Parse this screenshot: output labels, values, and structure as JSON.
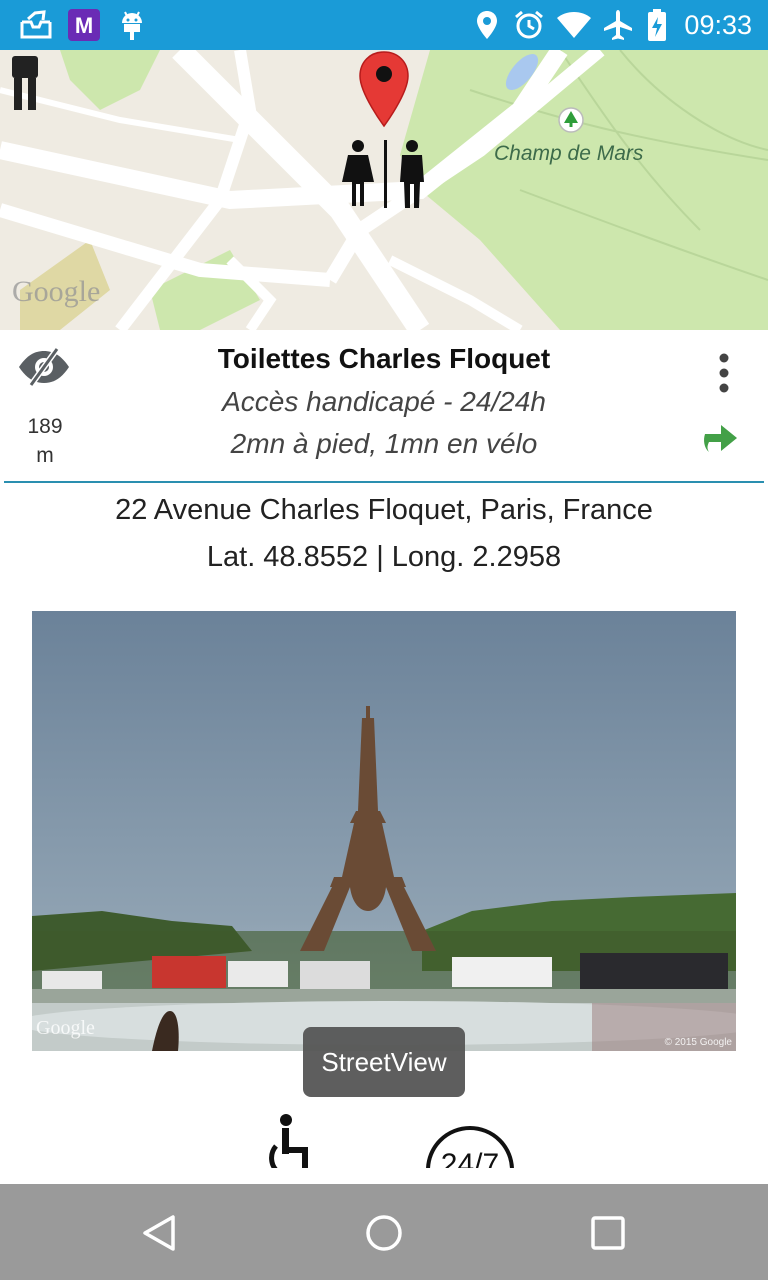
{
  "status_bar": {
    "time": "09:33",
    "left_icons": [
      "inbox-icon",
      "m-app-icon",
      "android-debug-icon"
    ],
    "right_icons": [
      "location-icon",
      "alarm-icon",
      "wifi-icon",
      "airplane-icon",
      "battery-charging-icon"
    ],
    "background_color": "#1a9bd7"
  },
  "map": {
    "place_label": "Champ de Mars",
    "attribution": "Google",
    "marker_icon": "map-pin-icon",
    "center_icon": "restroom-icon",
    "corner_icon": "toilet-person-icon"
  },
  "toilet": {
    "name": "Toilettes Charles Floquet",
    "accessibility_hours": "Accès handicapé - 24/24h",
    "travel_times": "2mn à pied, 1mn en vélo",
    "distance_value": "189",
    "distance_unit": "m",
    "address": "22 Avenue Charles Floquet, Paris, France",
    "coordinates": "Lat. 48.8552 | Long. 2.2958"
  },
  "photo": {
    "attribution": "Google",
    "copyright": "© 2015 Google"
  },
  "toast": {
    "label": "StreetView"
  },
  "features": {
    "open_label": "24/7",
    "wheelchair_icon": "wheelchair-icon"
  },
  "colors": {
    "accent": "#2a8fb0",
    "directions_green": "#4caf50",
    "marker_red": "#e53935"
  }
}
